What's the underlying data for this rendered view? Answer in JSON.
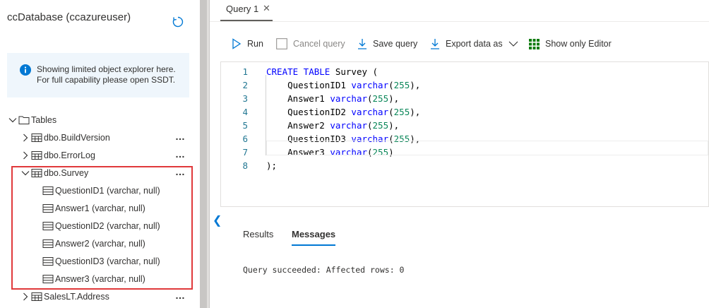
{
  "sidebar": {
    "database_title": "ccDatabase (ccazureuser)",
    "info": {
      "line1": "Showing limited object explorer here.",
      "line2": "For full capability please open SSDT."
    },
    "tables_label": "Tables",
    "tables": [
      {
        "name": "dbo.BuildVersion"
      },
      {
        "name": "dbo.ErrorLog"
      },
      {
        "name": "dbo.Survey"
      },
      {
        "name": "SalesLT.Address"
      }
    ],
    "survey_columns": [
      "QuestionID1 (varchar, null)",
      "Answer1 (varchar, null)",
      "QuestionID2 (varchar, null)",
      "Answer2 (varchar, null)",
      "QuestionID3 (varchar, null)",
      "Answer3 (varchar, null)"
    ],
    "more_label": "…",
    "highlight_color": "#e0393b"
  },
  "query_tab": {
    "label": "Query 1",
    "close": "✕"
  },
  "toolbar": {
    "run": "Run",
    "cancel": "Cancel query",
    "save": "Save query",
    "export": "Export data as",
    "show_editor": "Show only Editor"
  },
  "editor": {
    "lines": [
      {
        "n": "1",
        "parts": [
          {
            "t": "CREATE TABLE",
            "c": "kw"
          },
          {
            "t": " Survey (",
            "c": ""
          }
        ]
      },
      {
        "n": "2",
        "parts": [
          {
            "t": "    QuestionID1 ",
            "c": ""
          },
          {
            "t": "varchar",
            "c": "kw"
          },
          {
            "t": "(",
            "c": ""
          },
          {
            "t": "255",
            "c": "num"
          },
          {
            "t": "),",
            "c": ""
          }
        ]
      },
      {
        "n": "3",
        "parts": [
          {
            "t": "    Answer1 ",
            "c": ""
          },
          {
            "t": "varchar",
            "c": "kw"
          },
          {
            "t": "(",
            "c": ""
          },
          {
            "t": "255",
            "c": "num"
          },
          {
            "t": "),",
            "c": ""
          }
        ]
      },
      {
        "n": "4",
        "parts": [
          {
            "t": "    QuestionID2 ",
            "c": ""
          },
          {
            "t": "varchar",
            "c": "kw"
          },
          {
            "t": "(",
            "c": ""
          },
          {
            "t": "255",
            "c": "num"
          },
          {
            "t": "),",
            "c": ""
          }
        ]
      },
      {
        "n": "5",
        "parts": [
          {
            "t": "    Answer2 ",
            "c": ""
          },
          {
            "t": "varchar",
            "c": "kw"
          },
          {
            "t": "(",
            "c": ""
          },
          {
            "t": "255",
            "c": "num"
          },
          {
            "t": "),",
            "c": ""
          }
        ]
      },
      {
        "n": "6",
        "parts": [
          {
            "t": "    QuestionID3 ",
            "c": ""
          },
          {
            "t": "varchar",
            "c": "kw"
          },
          {
            "t": "(",
            "c": ""
          },
          {
            "t": "255",
            "c": "num"
          },
          {
            "t": "),",
            "c": ""
          }
        ]
      },
      {
        "n": "7",
        "parts": [
          {
            "t": "    Answer3 ",
            "c": ""
          },
          {
            "t": "varchar",
            "c": "kw"
          },
          {
            "t": "(",
            "c": ""
          },
          {
            "t": "255",
            "c": "num"
          },
          {
            "t": ")",
            "c": ""
          }
        ]
      },
      {
        "n": "8",
        "parts": [
          {
            "t": ");",
            "c": ""
          }
        ]
      }
    ]
  },
  "results": {
    "tabs": [
      "Results",
      "Messages"
    ],
    "active_tab": "Messages",
    "message": "Query succeeded: Affected rows: 0"
  },
  "colors": {
    "accent": "#0078d4",
    "keyword": "#0000ff",
    "number": "#098658",
    "line_number": "#237893"
  }
}
